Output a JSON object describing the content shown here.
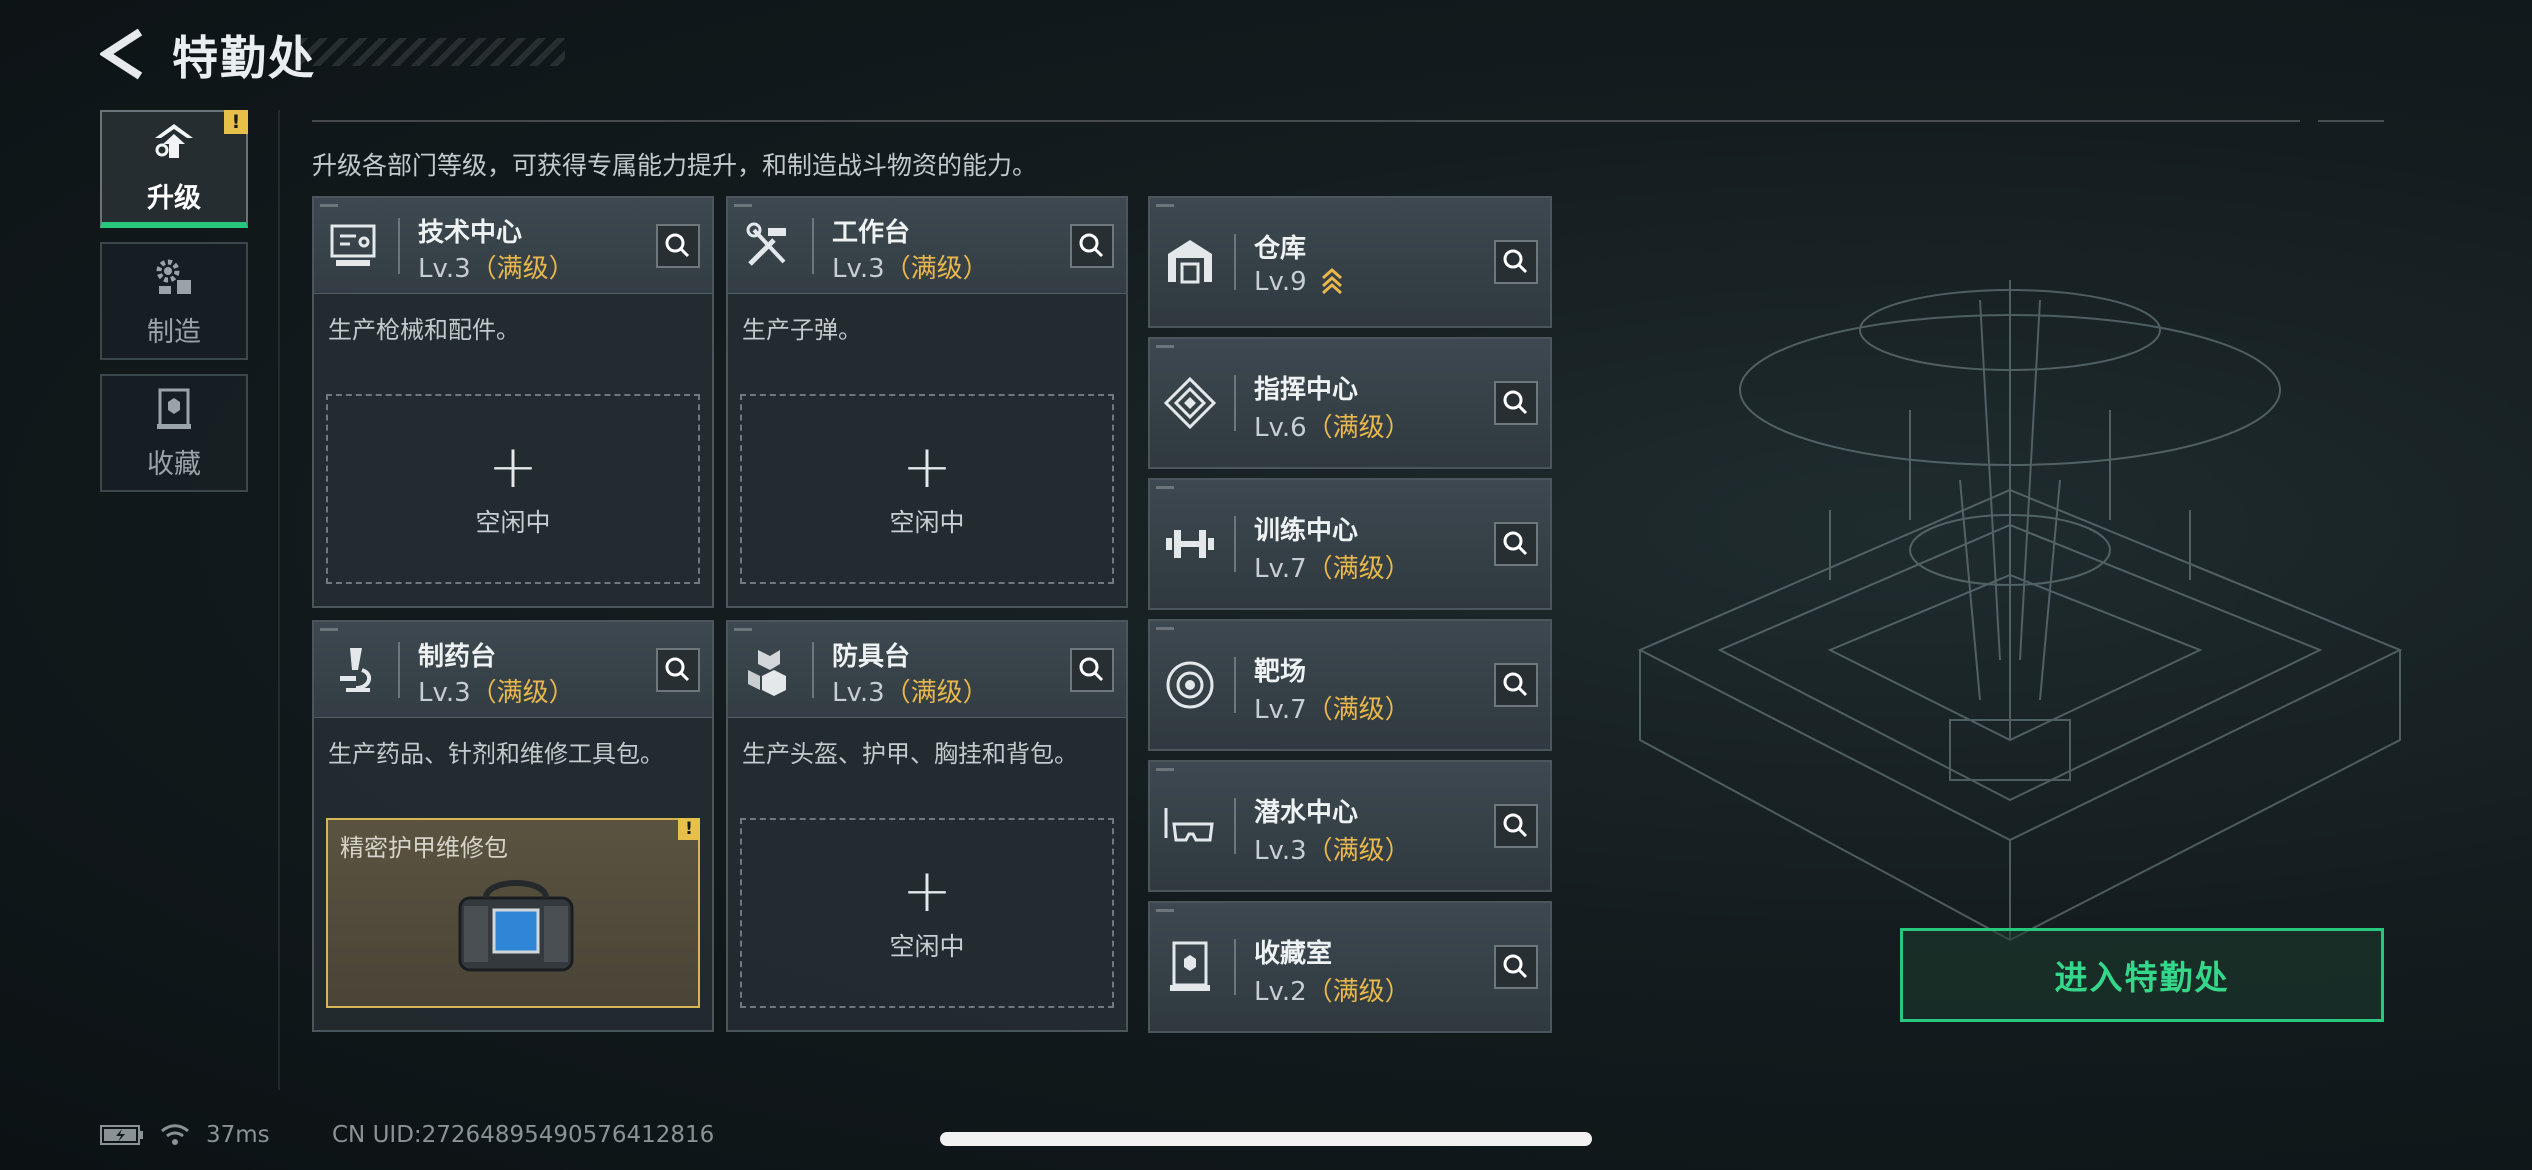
{
  "header": {
    "title": "特勤处"
  },
  "sidebar": {
    "items": [
      {
        "label": "升级",
        "icon": "upgrade-icon",
        "active": true,
        "badge": "!"
      },
      {
        "label": "制造",
        "icon": "gears-icon",
        "active": false
      },
      {
        "label": "收藏",
        "icon": "collection-icon",
        "active": false
      }
    ]
  },
  "main": {
    "description": "升级各部门等级，可获得专属能力提升，和制造战斗物资的能力。",
    "production_cards": [
      {
        "name": "技术中心",
        "level": "Lv.3",
        "status": "（满级）",
        "desc": "生产枪械和配件。",
        "slot": {
          "plus": "+",
          "label": "空闲中"
        }
      },
      {
        "name": "工作台",
        "level": "Lv.3",
        "status": "（满级）",
        "desc": "生产子弹。",
        "slot": {
          "plus": "+",
          "label": "空闲中"
        }
      },
      {
        "name": "制药台",
        "level": "Lv.3",
        "status": "（满级）",
        "desc": "生产药品、针剂和维修工具包。",
        "slot": {
          "item_name": "精密护甲维修包",
          "badge": "!"
        }
      },
      {
        "name": "防具台",
        "level": "Lv.3",
        "status": "（满级）",
        "desc": "生产头盔、护甲、胸挂和背包。",
        "slot": {
          "plus": "+",
          "label": "空闲中"
        }
      }
    ],
    "facilities": [
      {
        "name": "仓库",
        "level": "Lv.9",
        "status": "",
        "upgradable": true
      },
      {
        "name": "指挥中心",
        "level": "Lv.6",
        "status": "（满级）"
      },
      {
        "name": "训练中心",
        "level": "Lv.7",
        "status": "（满级）"
      },
      {
        "name": "靶场",
        "level": "Lv.7",
        "status": "（满级）"
      },
      {
        "name": "潜水中心",
        "level": "Lv.3",
        "status": "（满级）"
      },
      {
        "name": "收藏室",
        "level": "Lv.2",
        "status": "（满级）"
      }
    ],
    "enter_button": "进入特勤处"
  },
  "status_bar": {
    "ping": "37ms",
    "uid": "CN UID:2726489549057641281​6"
  },
  "colors": {
    "accent_green": "#27c77e",
    "max_level_gold": "#e8b84c",
    "badge_yellow": "#e7c04a"
  }
}
